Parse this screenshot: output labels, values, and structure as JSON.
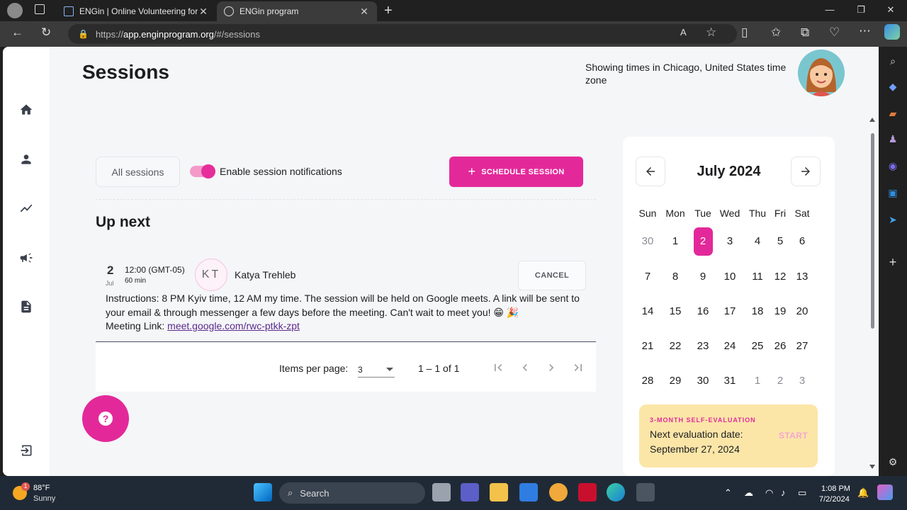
{
  "browser": {
    "tabs": [
      {
        "title": "ENGin | Online Volunteering for U",
        "active": false
      },
      {
        "title": "ENGin program",
        "active": true
      }
    ],
    "url_scheme": "https://",
    "url_host": "app.enginprogram.org",
    "url_path": "/#/sessions"
  },
  "header": {
    "title": "Sessions",
    "timezone_text": "Showing times in Chicago, United States time zone"
  },
  "toolbar": {
    "all_sessions_label": "All sessions",
    "notifications_label": "Enable session notifications",
    "notifications_enabled": true,
    "schedule_label": "SCHEDULE SESSION"
  },
  "up_next": {
    "heading": "Up next",
    "session": {
      "day": "2",
      "month": "Jul",
      "time": "12:00 (GMT-05)",
      "duration": "60 min",
      "initials": "KT",
      "name": "Katya Trehleb",
      "cancel_label": "CANCEL",
      "instructions": "Instructions: 8 PM Kyiv time, 12 AM my time. The session will be held on Google meets. A link will be sent to your email & through messenger a few days before the meeting. Can't wait to meet you! 😁 🎉",
      "link_label": "Meeting Link: ",
      "link_text": "meet.google.com/rwc-ptkk-zpt"
    }
  },
  "paginator": {
    "items_label": "Items per page:",
    "items_value": "3",
    "range": "1 – 1 of 1"
  },
  "calendar": {
    "title": "July 2024",
    "weekdays": [
      "Sun",
      "Mon",
      "Tue",
      "Wed",
      "Thu",
      "Fri",
      "Sat"
    ],
    "weeks": [
      [
        {
          "d": "30",
          "o": true
        },
        {
          "d": "1"
        },
        {
          "d": "2",
          "sel": true
        },
        {
          "d": "3"
        },
        {
          "d": "4"
        },
        {
          "d": "5"
        },
        {
          "d": "6"
        }
      ],
      [
        {
          "d": "7"
        },
        {
          "d": "8"
        },
        {
          "d": "9"
        },
        {
          "d": "10"
        },
        {
          "d": "11"
        },
        {
          "d": "12"
        },
        {
          "d": "13"
        }
      ],
      [
        {
          "d": "14"
        },
        {
          "d": "15"
        },
        {
          "d": "16"
        },
        {
          "d": "17"
        },
        {
          "d": "18"
        },
        {
          "d": "19"
        },
        {
          "d": "20"
        }
      ],
      [
        {
          "d": "21"
        },
        {
          "d": "22"
        },
        {
          "d": "23"
        },
        {
          "d": "24"
        },
        {
          "d": "25"
        },
        {
          "d": "26"
        },
        {
          "d": "27"
        }
      ],
      [
        {
          "d": "28"
        },
        {
          "d": "29"
        },
        {
          "d": "30"
        },
        {
          "d": "31"
        },
        {
          "d": "1",
          "o": true
        },
        {
          "d": "2",
          "o": true
        },
        {
          "d": "3",
          "o": true
        }
      ]
    ]
  },
  "evaluation": {
    "kicker": "3-MONTH SELF-EVALUATION",
    "text": "Next evaluation date: September 27, 2024",
    "start_label": "START"
  },
  "taskbar": {
    "weather_temp": "88°F",
    "weather_cond": "Sunny",
    "weather_badge": "1",
    "search_label": "Search",
    "time": "1:08 PM",
    "date": "7/2/2024"
  },
  "colors": {
    "accent": "#e3299a",
    "eval_bg": "#fbe6a8"
  }
}
